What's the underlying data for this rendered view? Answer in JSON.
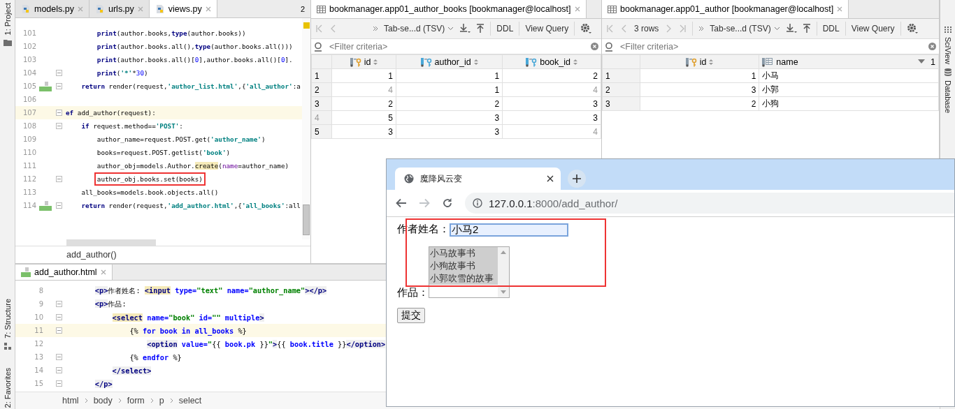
{
  "left_strip": [
    {
      "label": "1: Project"
    },
    {
      "label": "7: Structure"
    },
    {
      "label": "2: Favorites"
    }
  ],
  "editor": {
    "tabs": [
      {
        "label": "models.py",
        "selected": false
      },
      {
        "label": "urls.py",
        "selected": false
      },
      {
        "label": "views.py",
        "selected": true
      }
    ],
    "tab_overflow_count": "2",
    "lines": [
      {
        "number": "101",
        "current": false,
        "fold": false,
        "html_marker": false,
        "boxed": false,
        "tokens": [
          {
            "text": "        print",
            "kind": "b"
          },
          {
            "text": "(author.books,",
            "kind": "p"
          },
          {
            "text": "type",
            "kind": "b"
          },
          {
            "text": "(author.books))",
            "kind": "p"
          }
        ]
      },
      {
        "number": "102",
        "current": false,
        "fold": false,
        "html_marker": false,
        "boxed": false,
        "tokens": [
          {
            "text": "        print",
            "kind": "b"
          },
          {
            "text": "(author.books.all(),",
            "kind": "p"
          },
          {
            "text": "type",
            "kind": "b"
          },
          {
            "text": "(author.books.all()))",
            "kind": "p"
          }
        ]
      },
      {
        "number": "103",
        "current": false,
        "fold": false,
        "html_marker": false,
        "boxed": false,
        "tokens": [
          {
            "text": "        print",
            "kind": "b"
          },
          {
            "text": "(author.books.all()[",
            "kind": "p"
          },
          {
            "text": "0",
            "kind": "n"
          },
          {
            "text": "],author.books.all()[",
            "kind": "p"
          },
          {
            "text": "0",
            "kind": "n"
          },
          {
            "text": "].",
            "kind": "p"
          }
        ]
      },
      {
        "number": "104",
        "current": false,
        "fold": true,
        "html_marker": false,
        "boxed": false,
        "tokens": [
          {
            "text": "        print",
            "kind": "b"
          },
          {
            "text": "(",
            "kind": "p"
          },
          {
            "text": "'*'",
            "kind": "s"
          },
          {
            "text": "*",
            "kind": "p"
          },
          {
            "text": "30",
            "kind": "n"
          },
          {
            "text": ")",
            "kind": "p"
          }
        ]
      },
      {
        "number": "105",
        "current": false,
        "fold": true,
        "html_marker": true,
        "boxed": false,
        "tokens": [
          {
            "text": "    return",
            "kind": "b"
          },
          {
            "text": " render(request,",
            "kind": "p"
          },
          {
            "text": "'author_list.html'",
            "kind": "s"
          },
          {
            "text": ",{",
            "kind": "p"
          },
          {
            "text": "'all_author'",
            "kind": "s"
          },
          {
            "text": ":a",
            "kind": "p"
          }
        ]
      },
      {
        "number": "106",
        "current": false,
        "fold": false,
        "html_marker": false,
        "boxed": false
      },
      {
        "number": "107",
        "current": true,
        "fold": true,
        "html_marker": false,
        "boxed": false,
        "tokens": [
          {
            "text": "ef",
            "kind": "b"
          },
          {
            "text": " add_author(request):",
            "kind": "p"
          }
        ]
      },
      {
        "number": "108",
        "current": false,
        "fold": true,
        "html_marker": false,
        "boxed": false,
        "tokens": [
          {
            "text": "    if",
            "kind": "b"
          },
          {
            "text": " request.method==",
            "kind": "p"
          },
          {
            "text": "'POST'",
            "kind": "s"
          },
          {
            "text": ":",
            "kind": "p"
          }
        ]
      },
      {
        "number": "109",
        "current": false,
        "fold": false,
        "html_marker": false,
        "boxed": false,
        "tokens": [
          {
            "text": "        author_name=request.POST.get(",
            "kind": "p"
          },
          {
            "text": "'author_name'",
            "kind": "s"
          },
          {
            "text": ")",
            "kind": "p"
          }
        ]
      },
      {
        "number": "110",
        "current": false,
        "fold": false,
        "html_marker": false,
        "boxed": false,
        "tokens": [
          {
            "text": "        books=request.POST.getlist(",
            "kind": "p"
          },
          {
            "text": "'book'",
            "kind": "s"
          },
          {
            "text": ")",
            "kind": "p"
          }
        ]
      },
      {
        "number": "111",
        "current": false,
        "fold": false,
        "html_marker": false,
        "boxed": false,
        "tokens": [
          {
            "text": "        author_obj=models.Author.",
            "kind": "p"
          },
          {
            "text": "create",
            "kind": "h"
          },
          {
            "text": "(",
            "kind": "p"
          },
          {
            "text": "name",
            "kind": "a"
          },
          {
            "text": "=author_name)",
            "kind": "p"
          }
        ]
      },
      {
        "number": "112",
        "current": false,
        "fold": true,
        "html_marker": false,
        "boxed": true,
        "tokens": [
          {
            "text": "        author_obj.books.set(books)",
            "kind": "p"
          }
        ]
      },
      {
        "number": "113",
        "current": false,
        "fold": false,
        "html_marker": false,
        "boxed": false,
        "tokens": [
          {
            "text": "    all_books=models.book.objects.all()",
            "kind": "p"
          }
        ]
      },
      {
        "number": "114",
        "current": false,
        "fold": true,
        "html_marker": true,
        "boxed": false,
        "tokens": [
          {
            "text": "    return",
            "kind": "b"
          },
          {
            "text": " render(request,",
            "kind": "p"
          },
          {
            "text": "'add_author.html'",
            "kind": "s"
          },
          {
            "text": ",{",
            "kind": "p"
          },
          {
            "text": "'all_books'",
            "kind": "s"
          },
          {
            "text": ":all",
            "kind": "p"
          }
        ]
      }
    ],
    "breadcrumb": "add_author()"
  },
  "template_editor": {
    "tabs": [
      {
        "label": "add_author.html",
        "selected": true
      }
    ],
    "lines": [
      {
        "number": "8",
        "current": false,
        "fold": false,
        "tokens": [
          {
            "text": "    <p>",
            "kind": "t"
          },
          {
            "text": "作者姓名: ",
            "kind": "p"
          },
          {
            "text": "<input",
            "kind": "th"
          },
          {
            "text": " type=",
            "kind": "at"
          },
          {
            "text": "\"text\"",
            "kind": "v"
          },
          {
            "text": " name=",
            "kind": "at"
          },
          {
            "text": "\"author_name\"",
            "kind": "v"
          },
          {
            "text": "></p>",
            "kind": "t"
          }
        ]
      },
      {
        "number": "9",
        "current": false,
        "fold": true,
        "tokens": [
          {
            "text": "    <p>",
            "kind": "t"
          },
          {
            "text": "作品:",
            "kind": "p"
          }
        ]
      },
      {
        "number": "10",
        "current": false,
        "fold": true,
        "tokens": [
          {
            "text": "        <select",
            "kind": "th"
          },
          {
            "text": " name=",
            "kind": "at"
          },
          {
            "text": "\"book\"",
            "kind": "v"
          },
          {
            "text": " id=",
            "kind": "at"
          },
          {
            "text": "\"\"",
            "kind": "v"
          },
          {
            "text": " multiple",
            "kind": "at"
          },
          {
            "text": ">",
            "kind": "t"
          }
        ]
      },
      {
        "number": "11",
        "current": true,
        "fold": true,
        "tokens": [
          {
            "text": "            {% ",
            "kind": "p"
          },
          {
            "text": "for book in all_books",
            "kind": "at"
          },
          {
            "text": " %}",
            "kind": "p"
          }
        ]
      },
      {
        "number": "12",
        "current": false,
        "fold": false,
        "tokens": [
          {
            "text": "                <option",
            "kind": "t"
          },
          {
            "text": " value=",
            "kind": "at"
          },
          {
            "text": "\"",
            "kind": "v"
          },
          {
            "text": "{{ ",
            "kind": "p"
          },
          {
            "text": "book.pk",
            "kind": "at"
          },
          {
            "text": " }}",
            "kind": "p"
          },
          {
            "text": "\"",
            "kind": "v"
          },
          {
            "text": ">",
            "kind": "t"
          },
          {
            "text": "{{ ",
            "kind": "p"
          },
          {
            "text": "book.title",
            "kind": "at"
          },
          {
            "text": " }}",
            "kind": "p"
          },
          {
            "text": "</option>",
            "kind": "t"
          }
        ]
      },
      {
        "number": "13",
        "current": false,
        "fold": true,
        "tokens": [
          {
            "text": "            {% ",
            "kind": "p"
          },
          {
            "text": "endfor",
            "kind": "at"
          },
          {
            "text": " %}",
            "kind": "p"
          }
        ]
      },
      {
        "number": "14",
        "current": false,
        "fold": true,
        "tokens": [
          {
            "text": "        </select>",
            "kind": "t"
          }
        ]
      },
      {
        "number": "15",
        "current": false,
        "fold": true,
        "tokens": [
          {
            "text": "    </p>",
            "kind": "t"
          }
        ]
      }
    ],
    "breadcrumb": [
      "html",
      "body",
      "form",
      "p",
      "select"
    ]
  },
  "db_panels": [
    {
      "title": "bookmanager.app01_author_books [bookmanager@localhost]",
      "format": "Tab-se...d (TSV)",
      "buttons": [
        "DDL",
        "View Query"
      ],
      "filter_placeholder": "<Filter criteria>",
      "columns": [
        {
          "name": "id",
          "kind": "primary"
        },
        {
          "name": "author_id",
          "kind": "foreign"
        },
        {
          "name": "book_id",
          "kind": "foreign"
        }
      ],
      "rows": [
        {
          "number": {
            "value": "1",
            "dim": false
          },
          "cells": [
            {
              "value": "1",
              "dim": false
            },
            {
              "value": "1",
              "dim": false
            },
            {
              "value": "2",
              "dim": false
            }
          ]
        },
        {
          "number": {
            "value": "2",
            "dim": false
          },
          "cells": [
            {
              "value": "4",
              "dim": true
            },
            {
              "value": "1",
              "dim": false
            },
            {
              "value": "4",
              "dim": true
            }
          ]
        },
        {
          "number": {
            "value": "3",
            "dim": false
          },
          "cells": [
            {
              "value": "2",
              "dim": false
            },
            {
              "value": "2",
              "dim": false
            },
            {
              "value": "3",
              "dim": false
            }
          ]
        },
        {
          "number": {
            "value": "4",
            "dim": true
          },
          "cells": [
            {
              "value": "5",
              "dim": false
            },
            {
              "value": "3",
              "dim": false
            },
            {
              "value": "3",
              "dim": false
            }
          ]
        },
        {
          "number": {
            "value": "5",
            "dim": false
          },
          "cells": [
            {
              "value": "3",
              "dim": false
            },
            {
              "value": "3",
              "dim": false
            },
            {
              "value": "4",
              "dim": true
            }
          ]
        }
      ]
    },
    {
      "title": "bookmanager.app01_author [bookmanager@localhost]",
      "row_count": "3 rows",
      "format": "Tab-se...d (TSV)",
      "buttons": [
        "DDL",
        "View Query"
      ],
      "filter_placeholder": "<Filter criteria>",
      "columns": [
        {
          "name": "id",
          "kind": "primary"
        },
        {
          "name": "name",
          "kind": "plain",
          "sort_order": "1"
        }
      ],
      "rows": [
        {
          "number": {
            "value": "1",
            "dim": false
          },
          "cells": [
            {
              "value": "1",
              "dim": false
            },
            {
              "value": "小马",
              "dim": false
            }
          ]
        },
        {
          "number": {
            "value": "2",
            "dim": false
          },
          "cells": [
            {
              "value": "3",
              "dim": false
            },
            {
              "value": "小郭",
              "dim": false
            }
          ]
        },
        {
          "number": {
            "value": "3",
            "dim": false
          },
          "cells": [
            {
              "value": "2",
              "dim": false
            },
            {
              "value": "小狗",
              "dim": false
            }
          ]
        }
      ]
    }
  ],
  "right_strip": [
    {
      "label": "SciView"
    },
    {
      "label": "Database"
    }
  ],
  "browser": {
    "tab_title": "魔降风云变",
    "forward_disabled": true,
    "url_host": "127.0.0.1",
    "url_rest": ":8000/add_author/",
    "form": {
      "name_label": "作者姓名：",
      "name_value": "小马2",
      "books_label": "作品：",
      "options": [
        {
          "label": "小马故事书",
          "selected": true
        },
        {
          "label": "小狗故事书",
          "selected": true
        },
        {
          "label": "小郭吹雪的故事",
          "selected": true
        }
      ],
      "submit": "提交"
    }
  }
}
